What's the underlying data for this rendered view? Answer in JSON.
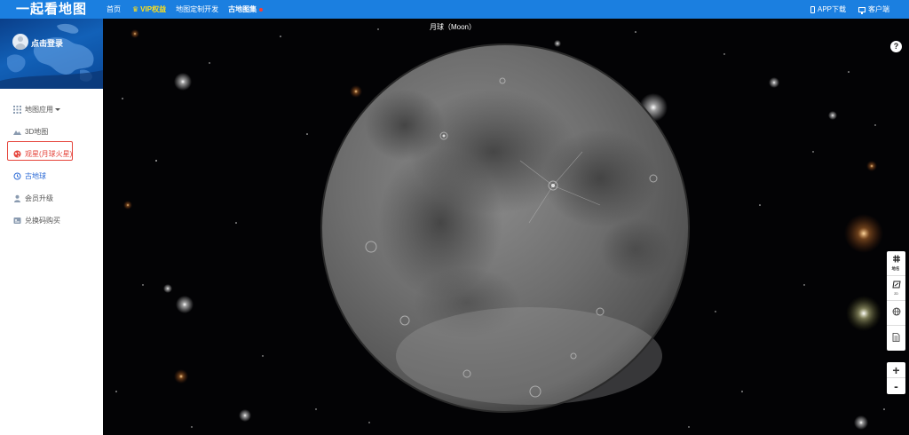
{
  "app": {
    "logo_text": "一起看地图",
    "brand_color": "#1b7fe0",
    "sidebar_bg": "#ffffff",
    "accent_red": "#e5443b"
  },
  "topnav": {
    "home": "首页",
    "vip": "VIP权益",
    "custom": "地图定制开发",
    "ancient": "古地图集",
    "app_download": "APP下载",
    "client": "客户端"
  },
  "sidebar": {
    "login_label": "点击登录",
    "items": [
      {
        "label": "地图应用",
        "icon": "grid-icon"
      },
      {
        "label": "3D地图",
        "icon": "mountain-icon"
      },
      {
        "label": "观星(月球火星)",
        "icon": "globe-icon",
        "active": true
      },
      {
        "label": "古地球",
        "icon": "history-icon"
      },
      {
        "label": "会员升级",
        "icon": "user-icon"
      },
      {
        "label": "兑换码购买",
        "icon": "card-icon"
      }
    ]
  },
  "map": {
    "title": "月球（Moon）",
    "help": "?"
  },
  "tools": {
    "items": [
      {
        "label": "地名",
        "icon": "place-name-icon"
      },
      {
        "label": "2D",
        "icon": "layer-2d-icon"
      },
      {
        "label": "",
        "icon": "globe-grid-icon"
      },
      {
        "label": "",
        "icon": "document-icon"
      }
    ],
    "zoom_in": "+",
    "zoom_out": "-"
  }
}
